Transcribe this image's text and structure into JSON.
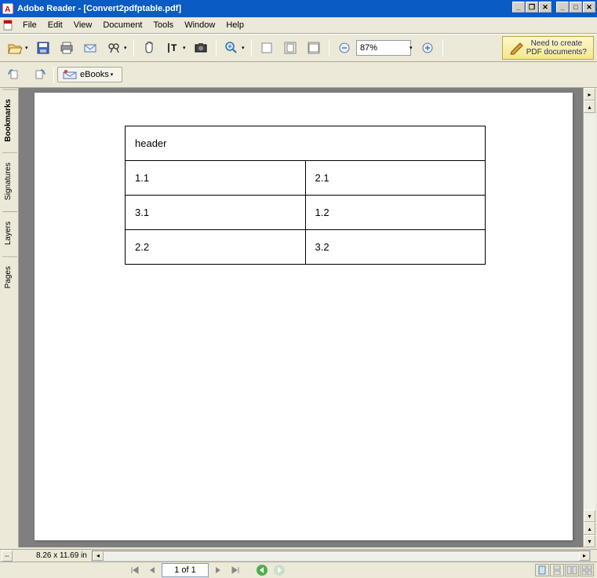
{
  "window": {
    "title": "Adobe Reader - [Convert2pdfptable.pdf]"
  },
  "menu": {
    "file": "File",
    "edit": "Edit",
    "view": "View",
    "document": "Document",
    "tools": "Tools",
    "window": "Window",
    "help": "Help"
  },
  "toolbar": {
    "zoom_value": "87%",
    "create_line1": "Need to create",
    "create_line2": "PDF documents?"
  },
  "toolbar2": {
    "ebooks_label": "eBooks"
  },
  "sidebar": {
    "tabs": {
      "bookmarks": "Bookmarks",
      "signatures": "Signatures",
      "layers": "Layers",
      "pages": "Pages"
    }
  },
  "document": {
    "table": {
      "header": "header",
      "rows": [
        [
          "1.1",
          "2.1"
        ],
        [
          "3.1",
          "1.2"
        ],
        [
          "2.2",
          "3.2"
        ]
      ]
    }
  },
  "bottom": {
    "dimensions": "8.26 x 11.69 in"
  },
  "status": {
    "page_display": "1 of 1"
  }
}
